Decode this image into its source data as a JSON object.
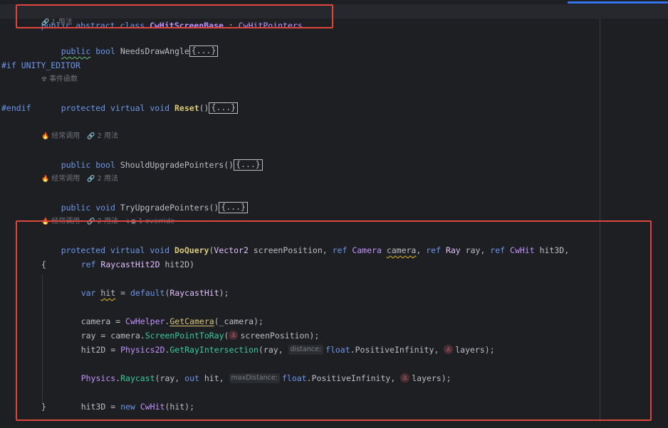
{
  "colors": {
    "accent": "#3574f0",
    "annotation_box": "#e0443e",
    "background": "#1e1f22"
  },
  "line1": {
    "kw1": "public",
    "kw2": "abstract",
    "kw3": "class",
    "class_name": "CwHitScreenBase",
    "colon": ":",
    "base_class": "CwHitPointers"
  },
  "hints": {
    "usages_1": "1 用法",
    "event_func": "事件函数",
    "frequent": "经常调用",
    "usages_2": "2 用法",
    "override": "1 override"
  },
  "code": {
    "public": "public",
    "protected": "protected",
    "virtual": "virtual",
    "bool": "bool",
    "void": "void",
    "var": "var",
    "ref": "ref",
    "out": "out",
    "new": "new",
    "default": "default",
    "float": "float",
    "needs_draw_angle": "NeedsDrawAngle",
    "fold": "{...}",
    "if_editor": "#if UNITY_EDITOR",
    "reset": "Reset",
    "endif": "#endif",
    "should_upgrade": "ShouldUpgradePointers",
    "try_upgrade": "TryUpgradePointers",
    "do_query": "DoQuery",
    "vector2": "Vector2",
    "screen_position": "screenPosition",
    "camera_t": "Camera",
    "camera_p": "camera",
    "ray_t": "Ray",
    "ray_p": "ray",
    "cwhit": "CwHit",
    "hit3d": "hit3D",
    "raycasthit2d": "RaycastHit2D",
    "hit2d": "hit2D",
    "open_brace": "{",
    "close_brace": "}",
    "hit": "hit",
    "raycasthit": "RaycastHit",
    "cwhelper": "CwHelper",
    "getcamera": "GetCamera",
    "_camera": "_camera",
    "screen_point_to_ray": "ScreenPointToRay",
    "physics2d": "Physics2D",
    "get_ray_intersection": "GetRayIntersection",
    "hint_distance": "distance:",
    "positive_infinity": "PositiveInfinity",
    "layers": "layers",
    "physics": "Physics",
    "raycast": "Raycast",
    "hint_max_distance": "maxDistance:"
  }
}
